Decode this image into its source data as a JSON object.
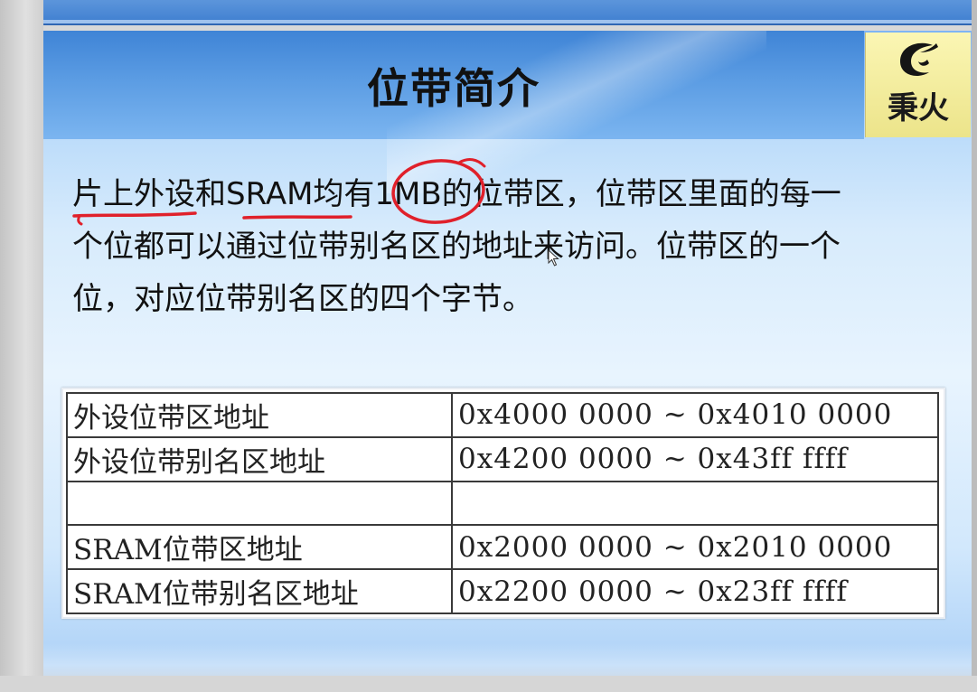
{
  "slide": {
    "title": "位带简介",
    "logo_text": "秉火",
    "logo_icon": "flame-logo-icon",
    "body_lines": [
      "片上外设和SRAM均有1MB的位带区，位带区里面的每一",
      "个位都可以通过位带别名区的地址来访问。位带区的一个",
      "位，对应位带别名区的四个字节。"
    ],
    "annotation_color": "#e0202a",
    "table": {
      "rows": [
        {
          "label": "外设位带区地址",
          "range": "0x4000 0000 ~ 0x4010 0000"
        },
        {
          "label": "外设位带别名区地址",
          "range": "0x4200 0000 ~ 0x43ff ffff"
        },
        {
          "label": "",
          "range": ""
        },
        {
          "label": "SRAM位带区地址",
          "range": "0x2000 0000 ~ 0x2010 0000"
        },
        {
          "label": "SRAM位带别名区地址",
          "range": "0x2200 0000 ~ 0x23ff ffff"
        }
      ]
    }
  }
}
